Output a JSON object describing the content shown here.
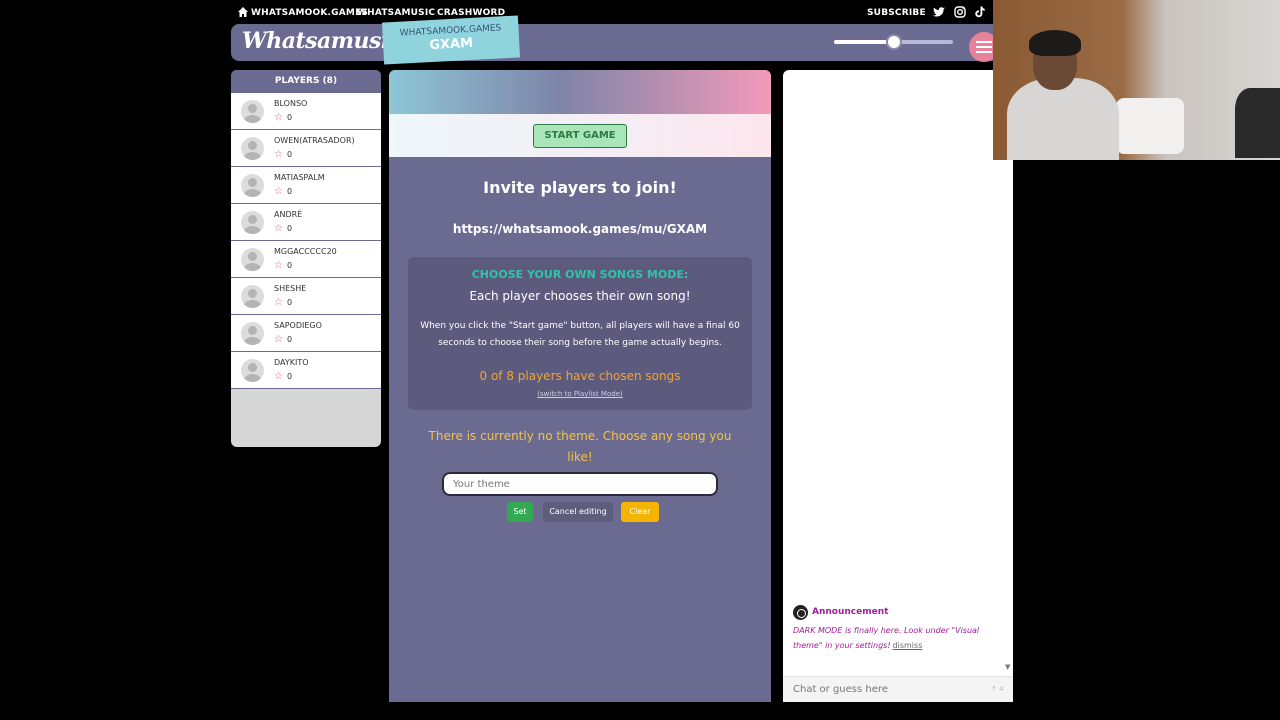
{
  "topnav": {
    "links": [
      "WHATSAMOOK.GAMES",
      "WHATSAMUSIC",
      "CRASHWORD"
    ],
    "subscribe": "SUBSCRIBE",
    "social_icons": [
      "twitter-icon",
      "instagram-icon",
      "tiktok-icon"
    ]
  },
  "header": {
    "logo": "Whatsamusic",
    "room_site": "WHATSAMOOK.GAMES",
    "room_code": "GXAM",
    "volume_level": 0.5
  },
  "players": {
    "title": "PLAYERS (8)",
    "list": [
      {
        "name": "BLONSO",
        "score": "0"
      },
      {
        "name": "OWEN(ATRASADOR)",
        "score": "0"
      },
      {
        "name": "MATIASPALM",
        "score": "0"
      },
      {
        "name": "ANDRÉ",
        "score": "0"
      },
      {
        "name": "MGGACCCCC20",
        "score": "0"
      },
      {
        "name": "SHESHE",
        "score": "0"
      },
      {
        "name": "SAPODIEGO",
        "score": "0"
      },
      {
        "name": "DAYKITO",
        "score": "0"
      }
    ]
  },
  "main": {
    "start_button": "START GAME",
    "invite_title": "Invite players to join!",
    "invite_link": "https://whatsamook.games/mu/GXAM",
    "mode": {
      "title": "CHOOSE YOUR OWN SONGS MODE:",
      "subtitle": "Each player chooses their own song!",
      "description": "When you click the \"Start game\" button, all players will have a final 60 seconds to choose their song before the game actually begins.",
      "count": "0 of 8 players have chosen songs",
      "switch_link": "(switch to Playlist Mode)"
    },
    "no_theme": "There is currently no theme. Choose any song you like!",
    "theme_input": {
      "placeholder": "Your theme",
      "value": ""
    },
    "buttons": {
      "set": "Set",
      "cancel": "Cancel editing",
      "clear": "Clear"
    }
  },
  "chat": {
    "announcement": {
      "title": "Announcement",
      "body": "DARK MODE is finally here. Look under \"Visual theme\" in your settings!",
      "dismiss": "dismiss"
    },
    "input_placeholder": "Chat or guess here",
    "char_count": "↑ 4"
  },
  "colors": {
    "panel": "#6b6a91",
    "accent_teal": "#31c4a8",
    "accent_orange": "#f5a52c",
    "announcement": "#a1209b"
  }
}
